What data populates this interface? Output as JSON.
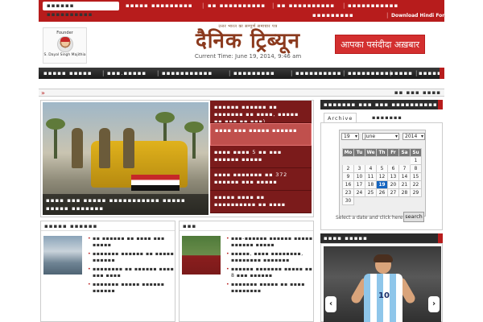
{
  "topbar": {
    "active_tab": "▪▪▪▪▪▪ ▪▪▪▪▪▪▪▪▪▪",
    "links": [
      {
        "label": "▪▪▪▪▪ ▪▪▪▪▪▪▪▪▪"
      },
      {
        "label": "▪▪ ▪▪▪▪▪▪▪▪▪▪"
      },
      {
        "label": "▪▪ ▪▪▪▪▪▪▪▪▪▪"
      },
      {
        "label": "▪▪▪▪▪▪▪▪▪▪▪"
      },
      {
        "label": "▪▪▪▪▪▪▪▪▪"
      },
      {
        "label": "Download Hindi Font"
      }
    ]
  },
  "header": {
    "founder_label": "Founder",
    "founder_name": "S. Dayal Singh Majithia",
    "logo_tagline": "उत्तर भारत का सम्पूर्ण समाचार पत्र",
    "logo_text": "दैनिक ट्रिब्यून",
    "current_time": "Current Time: June 19, 2014, 9:46 am",
    "ad_text": "आपका पसंदीदा अख़बार"
  },
  "nav": {
    "items": [
      {
        "label": "▪▪▪▪▪ ▪▪▪▪▪"
      },
      {
        "label": "▪▪▪.▪▪▪▪▪"
      },
      {
        "label": "▪▪▪▪▪▪▪▪▪▪▪"
      },
      {
        "label": "▪▪▪▪▪▪▪▪▪"
      },
      {
        "label": "▪▪▪▪▪▪▪▪▪▪"
      },
      {
        "label": "▪▪▪▪▪▪▪▪▪▪"
      },
      {
        "label": "▪▪▪▪"
      },
      {
        "label": "▪▪▪▪▪▪▪"
      }
    ]
  },
  "ticker": {
    "text": "▪▪ ▪▪▪ ▪▪▪▪"
  },
  "slider": {
    "caption": "▪▪▪▪ ▪▪▪ ▪▪▪▪▪ ▪▪▪▪▪▪▪▪▪▪▪ ▪▪▪▪▪ ▪▪▪▪▪ ▪▪▪▪▪▪▪",
    "items": [
      {
        "text": "▪▪▪▪▪▪ ▪▪▪▪▪▪ ▪▪ ▪▪▪▪▪▪▪ ▪▪ ▪▪▪▪, ▪▪▪▪▪ ▪▪ ▪▪▪ ▪▪ ▪▪▪)"
      },
      {
        "text": "▪▪▪▪ ▪▪▪ ▪▪▪▪▪ ▪▪▪▪▪▪"
      },
      {
        "text": "▪▪▪▪ ▪▪▪▪ 5 ▪▪ ▪▪▪ ▪▪▪▪▪▪ ▪▪▪▪▪"
      },
      {
        "text": "▪▪▪▪ ▪▪▪▪▪▪▪ ▪▪ 372 ▪▪▪▪▪▪ ▪▪▪ ▪▪▪▪▪"
      },
      {
        "text": "▪▪▪▪▪ ▪▪▪▪ ▪▪ ▪▪▪▪▪▪▪▪▪▪ ▪▪ ▪▪▪▪"
      }
    ]
  },
  "section_left": {
    "title": "▪▪▪▪▪ ▪▪▪▪▪▪",
    "items": [
      {
        "text": "▪▪ ▪▪▪▪▪▪ ▪▪ ▪▪▪▪ ▪▪▪ ▪▪▪▪▪"
      },
      {
        "text": "▪▪▪▪▪▪▪ ▪▪▪▪▪▪ ▪▪ ▪▪▪▪▪ ▪▪▪▪▪▪"
      },
      {
        "text": "▪▪▪▪▪▪▪▪ ▪▪ ▪▪▪▪▪▪ ▪▪▪▪ ▪▪▪ ▪▪▪▪"
      },
      {
        "text": "▪▪▪▪▪▪▪ ▪▪▪▪▪ ▪▪▪▪▪▪ ▪▪▪▪▪▪"
      }
    ]
  },
  "section_mid": {
    "title": "▪▪▪",
    "items": [
      {
        "text": "▪▪▪-▪▪▪▪▪▪ ▪▪▪▪▪▪ ▪▪▪▪▪ ▪▪▪▪▪▪ ▪▪▪▪▪"
      },
      {
        "text": "▪▪▪▪▪, ▪▪▪▪ ▪▪▪▪▪▪▪▪, ▪▪▪▪▪▪▪▪ ▪▪▪▪▪▪▪"
      },
      {
        "text": "▪▪▪▪▪▪ ▪▪▪▪▪▪▪ ▪▪▪▪▪ ▪▪ 8 ▪▪▪ ▪▪▪▪▪▪"
      },
      {
        "text": "▪▪▪▪▪▪▪ ▪▪▪▪▪ ▪▪ ▪▪▪▪ ▪▪▪▪▪▪▪▪"
      }
    ]
  },
  "archive": {
    "header": "▪▪▪▪▪▪▪ ▪▪▪ ▪▪▪ ▪▪▪▪▪▪▪▪▪▪",
    "tabs": [
      {
        "label": "Archive"
      },
      {
        "label": "▪▪▪▪▪▪▪"
      }
    ],
    "day": "19",
    "month": "June",
    "year": "2014",
    "weekdays": [
      "Mo",
      "Tu",
      "We",
      "Th",
      "Fr",
      "Sa",
      "Su"
    ],
    "weeks": [
      [
        "",
        "",
        "",
        "",
        "",
        "",
        "1"
      ],
      [
        "2",
        "3",
        "4",
        "5",
        "6",
        "7",
        "8"
      ],
      [
        "9",
        "10",
        "11",
        "12",
        "13",
        "14",
        "15"
      ],
      [
        "16",
        "17",
        "18",
        "19",
        "20",
        "21",
        "22"
      ],
      [
        "23",
        "24",
        "25",
        "26",
        "27",
        "28",
        "29"
      ],
      [
        "30",
        "",
        "",
        "",
        "",
        "",
        ""
      ]
    ],
    "today": "19",
    "hint": "Select a date and click here",
    "button": "search"
  },
  "video": {
    "header": "▪▪▪▪ ▪▪▪▪▪",
    "jersey_number": "10",
    "prev_icon": "‹",
    "next_icon": "›"
  },
  "colors": {
    "brand_red": "#b71c1c",
    "logo_brown": "#8b3a1e",
    "nav_dark": "#2b2b2b",
    "calendar_today": "#1565c0"
  }
}
